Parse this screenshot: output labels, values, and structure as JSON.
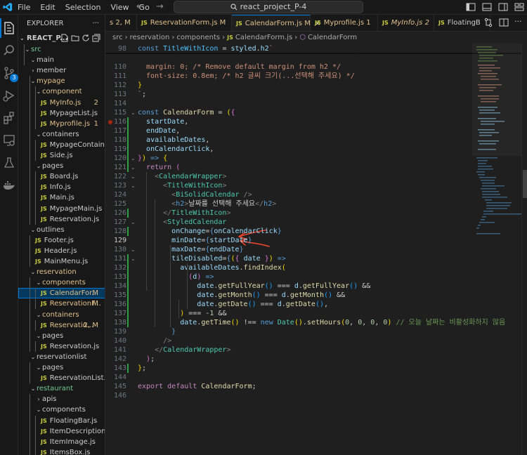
{
  "titlebar": {
    "menu": [
      "File",
      "Edit",
      "Selection",
      "View",
      "Go"
    ],
    "back_arrow": "←",
    "forward_arrow": "→",
    "search_text": "react_project_P-4"
  },
  "activity_bar": {
    "icons": [
      "explorer-icon",
      "search-icon",
      "source-control-icon",
      "run-debug-icon",
      "extensions-icon",
      "remote-explorer-icon",
      "testing-icon",
      "docker-icon"
    ],
    "scm_badge": "3"
  },
  "sidebar": {
    "title": "EXPLORER",
    "more": "···",
    "project": "REACT_P...",
    "tree": [
      {
        "label": "src",
        "kind": "folder",
        "indent": 1,
        "open": true,
        "color": "#73c991"
      },
      {
        "label": "main",
        "kind": "folder",
        "indent": 2,
        "open": true
      },
      {
        "label": "member",
        "kind": "folder",
        "indent": 2,
        "open": false
      },
      {
        "label": "mypage",
        "kind": "folder",
        "indent": 2,
        "open": true,
        "color": "#e2c08d"
      },
      {
        "label": "component",
        "kind": "folder",
        "indent": 3,
        "open": true,
        "color": "#e2c08d"
      },
      {
        "label": "MyInfo.js",
        "kind": "file",
        "indent": 4,
        "color": "#e2c08d",
        "status": "2"
      },
      {
        "label": "MypageList.js",
        "kind": "file",
        "indent": 4
      },
      {
        "label": "Myprofile.js",
        "kind": "file",
        "indent": 4,
        "color": "#e2c08d",
        "status": "1"
      },
      {
        "label": "containers",
        "kind": "folder",
        "indent": 3,
        "open": true
      },
      {
        "label": "MypageContainer.js",
        "kind": "file",
        "indent": 4
      },
      {
        "label": "Side.js",
        "kind": "file",
        "indent": 4
      },
      {
        "label": "pages",
        "kind": "folder",
        "indent": 3,
        "open": true
      },
      {
        "label": "Board.js",
        "kind": "file",
        "indent": 4
      },
      {
        "label": "Info.js",
        "kind": "file",
        "indent": 4
      },
      {
        "label": "Main.js",
        "kind": "file",
        "indent": 4
      },
      {
        "label": "MypageMain.js",
        "kind": "file",
        "indent": 4
      },
      {
        "label": "Reservation.js",
        "kind": "file",
        "indent": 4
      },
      {
        "label": "outlines",
        "kind": "folder",
        "indent": 2,
        "open": true
      },
      {
        "label": "Footer.js",
        "kind": "file",
        "indent": 3
      },
      {
        "label": "Header.js",
        "kind": "file",
        "indent": 3
      },
      {
        "label": "MainMenu.js",
        "kind": "file",
        "indent": 3
      },
      {
        "label": "reservation",
        "kind": "folder",
        "indent": 2,
        "open": true,
        "color": "#e2c08d"
      },
      {
        "label": "components",
        "kind": "folder",
        "indent": 3,
        "open": true,
        "color": "#e2c08d"
      },
      {
        "label": "CalendarFor...",
        "kind": "file",
        "indent": 4,
        "color": "#e2c08d",
        "status": "M",
        "selected": true
      },
      {
        "label": "ReservationF...",
        "kind": "file",
        "indent": 4,
        "color": "#e2c08d",
        "status": "M"
      },
      {
        "label": "containers",
        "kind": "folder",
        "indent": 3,
        "open": true,
        "color": "#e2c08d"
      },
      {
        "label": "Reservatio...",
        "kind": "file",
        "indent": 4,
        "color": "#e2c08d",
        "status": "2, M"
      },
      {
        "label": "pages",
        "kind": "folder",
        "indent": 3,
        "open": true
      },
      {
        "label": "Reservation.js",
        "kind": "file",
        "indent": 4
      },
      {
        "label": "reservationlist",
        "kind": "folder",
        "indent": 2,
        "open": true
      },
      {
        "label": "pages",
        "kind": "folder",
        "indent": 3,
        "open": true
      },
      {
        "label": "ReservationList.js",
        "kind": "file",
        "indent": 4
      },
      {
        "label": "restaurant",
        "kind": "folder",
        "indent": 2,
        "open": true,
        "color": "#73c991"
      },
      {
        "label": "apis",
        "kind": "folder",
        "indent": 3,
        "open": false
      },
      {
        "label": "components",
        "kind": "folder",
        "indent": 3,
        "open": true
      },
      {
        "label": "FloatingBar.js",
        "kind": "file",
        "indent": 4
      },
      {
        "label": "ItemDescription.js",
        "kind": "file",
        "indent": 4
      },
      {
        "label": "ItemImage.js",
        "kind": "file",
        "indent": 4
      },
      {
        "label": "ItemsBox.js",
        "kind": "file",
        "indent": 4
      }
    ]
  },
  "tabs": [
    {
      "label": "s 2, M",
      "prefix": "",
      "color": "#e2c08d",
      "active": false
    },
    {
      "label": "ReservationForm.js M",
      "prefix": "JS",
      "color": "#e2c08d",
      "active": false
    },
    {
      "label": "CalendarForm.js M",
      "prefix": "JS",
      "color": "#e2c08d",
      "active": true,
      "close": "×"
    },
    {
      "label": "Myprofile.js 1",
      "prefix": "JS",
      "color": "#e2c08d",
      "active": false
    },
    {
      "label": "MyInfo.js 2",
      "prefix": "JS",
      "color": "#e2c08d",
      "active": false
    },
    {
      "label": "FloatingBarCo",
      "prefix": "JS",
      "color": "#cccccc",
      "active": false
    }
  ],
  "breadcrumb": {
    "parts": [
      "src",
      "reservation",
      "components"
    ],
    "file": "CalendarForm.js",
    "symbol": "CalendarForm"
  },
  "editor": {
    "current_line": "129",
    "lines": [
      {
        "n": "98",
        "html": "<span class=\"k\">const</span> <span class=\"cn\">TitleWithIcon</span> = <span class=\"v\">styled</span>.<span class=\"v\">h2</span><span class=\"s\">`</span>"
      },
      {
        "n": "110",
        "html": "<span class=\"s\">  margin: 0; /* Remove default margin from h2 */</span>"
      },
      {
        "n": "111",
        "html": "<span class=\"s\">  font-size: 0.8em; /* h2 글씨 크기(...선택해 주세요) */</span>"
      },
      {
        "n": "112",
        "html": "<span class=\"y\">}</span>"
      },
      {
        "n": "113",
        "html": "<span class=\"s\">`</span>;"
      },
      {
        "n": "114",
        "html": ""
      },
      {
        "n": "115",
        "html": "<span class=\"k\">const</span> <span class=\"f\">CalendarForm</span> = <span class=\"y\">(</span><span class=\"pk\">{</span>"
      },
      {
        "n": "116",
        "html": "  <span class=\"v\">startDate</span>,"
      },
      {
        "n": "117",
        "html": "  <span class=\"v\">endDate</span>,"
      },
      {
        "n": "118",
        "html": "  <span class=\"v\">availableDates</span>,"
      },
      {
        "n": "119",
        "html": "  <span class=\"v\">onCalendarClick</span>,"
      },
      {
        "n": "120",
        "html": "<span class=\"pk\">}</span><span class=\"y\">)</span> <span class=\"k\">=&gt;</span> <span class=\"y\">{</span>"
      },
      {
        "n": "121",
        "html": "  <span class=\"c\">return</span> <span class=\"pk\">(</span>"
      },
      {
        "n": "122",
        "html": "    <span class=\"tg\">&lt;</span><span class=\"t\">CalendarWrapper</span><span class=\"tg\">&gt;</span>"
      },
      {
        "n": "123",
        "html": "      <span class=\"tg\">&lt;</span><span class=\"t\">TitleWithIcon</span><span class=\"tg\">&gt;</span>"
      },
      {
        "n": "124",
        "html": "        <span class=\"tg\">&lt;</span><span class=\"t\">BiSolidCalendar</span> <span class=\"tg\">/&gt;</span>"
      },
      {
        "n": "125",
        "html": "        <span class=\"tg\">&lt;</span><span class=\"k\">h2</span><span class=\"tg\">&gt;</span>날짜를 선택해 주세요<span class=\"tg\">&lt;/</span><span class=\"k\">h2</span><span class=\"tg\">&gt;</span>"
      },
      {
        "n": "126",
        "html": "      <span class=\"tg\">&lt;/</span><span class=\"t\">TitleWithIcon</span><span class=\"tg\">&gt;</span>"
      },
      {
        "n": "127",
        "html": "      <span class=\"tg\">&lt;</span><span class=\"t\">StyledCalendar</span>"
      },
      {
        "n": "128",
        "html": "        <span class=\"v\">onChange</span>=<span class=\"k\">{</span><span class=\"v\">onCalendarClick</span><span class=\"k\">}</span>"
      },
      {
        "n": "129",
        "html": "        <span class=\"v\">minDate</span>=<span class=\"k\">{</span><span class=\"v\">startDate</span><span class=\"k\">}</span>"
      },
      {
        "n": "130",
        "html": "        <span class=\"v\">maxDate</span>=<span class=\"k\">{</span><span class=\"v\">endDate</span><span class=\"k\">}</span>"
      },
      {
        "n": "131",
        "html": "        <span class=\"v\">tileDisabled</span>=<span class=\"k\">{</span><span class=\"y\">(</span><span class=\"pk\">{</span> <span class=\"v\">date</span> <span class=\"pk\">}</span><span class=\"y\">)</span> <span class=\"k\">=&gt;</span>"
      },
      {
        "n": "132",
        "html": "          <span class=\"v\">availableDates</span>.<span class=\"f\">findIndex</span><span class=\"y\">(</span>"
      },
      {
        "n": "133",
        "html": "            <span class=\"pk\">(</span><span class=\"v\">d</span><span class=\"pk\">)</span> <span class=\"k\">=&gt;</span>"
      },
      {
        "n": "134",
        "html": "              <span class=\"v\">date</span>.<span class=\"f\">getFullYear</span><span class=\"bl\">()</span> === <span class=\"v\">d</span>.<span class=\"f\">getFullYear</span><span class=\"bl\">()</span> &amp;&amp;"
      },
      {
        "n": "135",
        "html": "              <span class=\"v\">date</span>.<span class=\"f\">getMonth</span><span class=\"bl\">()</span> === <span class=\"v\">d</span>.<span class=\"f\">getMonth</span><span class=\"bl\">()</span> &amp;&amp;"
      },
      {
        "n": "136",
        "html": "              <span class=\"v\">date</span>.<span class=\"f\">getDate</span><span class=\"bl\">()</span> === <span class=\"v\">d</span>.<span class=\"f\">getDate</span><span class=\"bl\">()</span>,"
      },
      {
        "n": "137",
        "html": "          <span class=\"y\">)</span> === -<span class=\"n\">1</span> &amp;&amp;"
      },
      {
        "n": "138",
        "html": "          <span class=\"v\">date</span>.<span class=\"f\">getTime</span><span class=\"y\">()</span> !== <span class=\"k\">new</span> <span class=\"t\">Date</span><span class=\"y\">()</span>.<span class=\"f\">setHours</span><span class=\"y\">(</span><span class=\"n\">0</span>, <span class=\"n\">0</span>, <span class=\"n\">0</span>, <span class=\"n\">0</span><span class=\"y\">)</span> <span class=\"cm\">// 오늘 날짜는 비활성화하지 않음</span>"
      },
      {
        "n": "139",
        "html": "        <span class=\"k\">}</span>"
      },
      {
        "n": "140",
        "html": "      <span class=\"tg\">/&gt;</span>"
      },
      {
        "n": "141",
        "html": "    <span class=\"tg\">&lt;/</span><span class=\"t\">CalendarWrapper</span><span class=\"tg\">&gt;</span>"
      },
      {
        "n": "142",
        "html": "  <span class=\"pk\">)</span>;"
      },
      {
        "n": "143",
        "html": "<span class=\"y\">}</span>;"
      },
      {
        "n": "144",
        "html": ""
      },
      {
        "n": "145",
        "html": "<span class=\"c\">export</span> <span class=\"c\">default</span> <span class=\"f\">CalendarForm</span>;"
      },
      {
        "n": "146",
        "html": ""
      }
    ]
  },
  "colors": {
    "accent": "#0078d4",
    "annotation_arrow": "#e8452c",
    "modified": "#e2c08d",
    "untracked": "#73c991"
  }
}
